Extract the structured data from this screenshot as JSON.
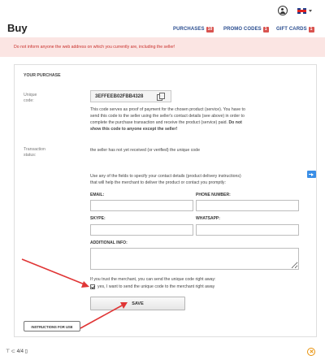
{
  "header": {
    "title": "Buy",
    "nav": [
      {
        "label": "PURCHASES",
        "badge": "10"
      },
      {
        "label": "PROMO CODES",
        "badge": "1"
      },
      {
        "label": "GIFT CARDS",
        "badge": "1"
      }
    ]
  },
  "alert": {
    "text": "Do not inform anyone the web address on which you currently are, including the seller!",
    "color": "#c9302c"
  },
  "purchase": {
    "section_title": "YOUR PURCHASE",
    "unique_code_label_1": "Unique",
    "unique_code_label_2": "code:",
    "unique_code": "3EFFEEB02FBB4328",
    "description_line1": "This code serves as proof of payment for the chosen product (service). You have to",
    "description_line2": "send this code to the seller using the seller's contact details (see above) in order to",
    "description_line3": "complete the purchase transaction and receive the product (service) paid.",
    "description_bold_a": "Do not",
    "description_bold_b": "show this code to anyone except the seller!",
    "status_label_1": "Transaction",
    "status_label_2": "status:",
    "status_text": "the seller has not yet received (or verified) the unique code"
  },
  "contact": {
    "intro_line1": "Use any of the fields to specify your contact details (product delivery instructions)",
    "intro_line2": "that will help the merchant to deliver the product or contact you promptly:",
    "email_label": "EMAIL:",
    "phone_label": "PHONE NUMBER:",
    "skype_label": "SKYPE:",
    "whatsapp_label": "WHATSAPP:",
    "additional_label": "ADDITIONAL INFO:",
    "email_value": "",
    "phone_value": "",
    "skype_value": "",
    "whatsapp_value": "",
    "additional_value": ""
  },
  "consent": {
    "trust_text": "If you trust the merchant, you can send the unique code right away:",
    "checkbox_label": "yes, I want to send the unique code to the merchant right away",
    "checked": true
  },
  "buttons": {
    "save": "SAVE",
    "instructions": "INSTRUCTIONS FOR USE"
  },
  "footer": {
    "page_indicator": "⊤ ⊂ 4/4 ▯"
  },
  "colors": {
    "accent": "#2a4d8f",
    "badge": "#d9534f",
    "alert_bg": "#fbe5e3",
    "annotation_arrow": "#e03535",
    "nav_arrow": "#3a8ee6",
    "close_icon": "#e8920c"
  },
  "icons": [
    "user-icon",
    "flag-icon",
    "copy-icon",
    "arrow-right-icon",
    "close-circle-icon"
  ]
}
